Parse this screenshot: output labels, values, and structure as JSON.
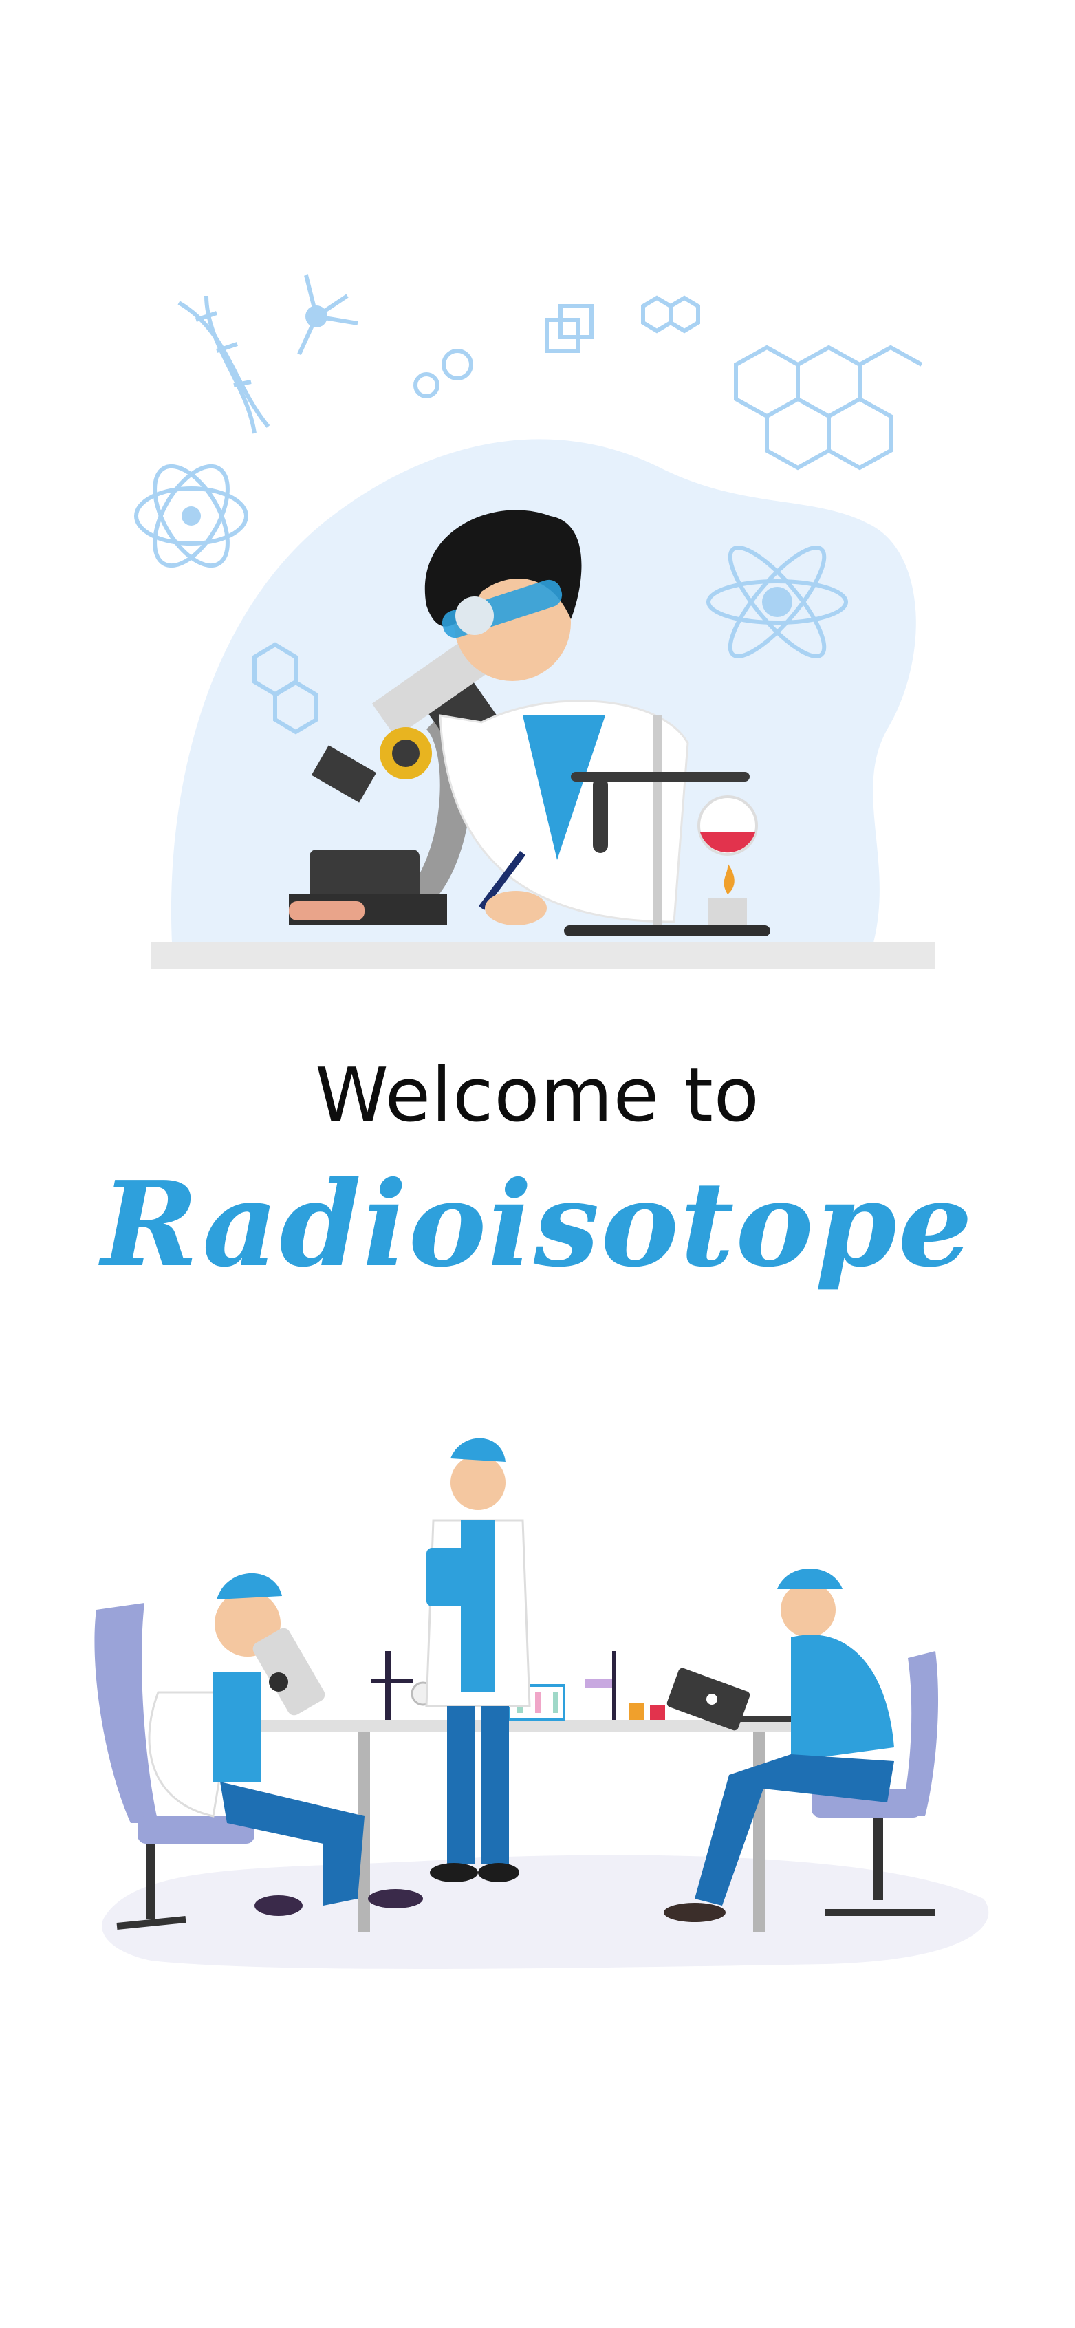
{
  "welcome": {
    "line1": "Welcome to",
    "brand": "Radioisotope"
  },
  "colors": {
    "brand_blue": "#2ea0dc",
    "light_blue_blob": "#e6f1fc",
    "icon_blue": "#a9d2f3",
    "text_dark": "#0d0d0d",
    "chair_purple": "#9aa3d8"
  },
  "illustrations": {
    "hero": "scientist-with-microscope-illustration",
    "team": "lab-team-illustration"
  }
}
